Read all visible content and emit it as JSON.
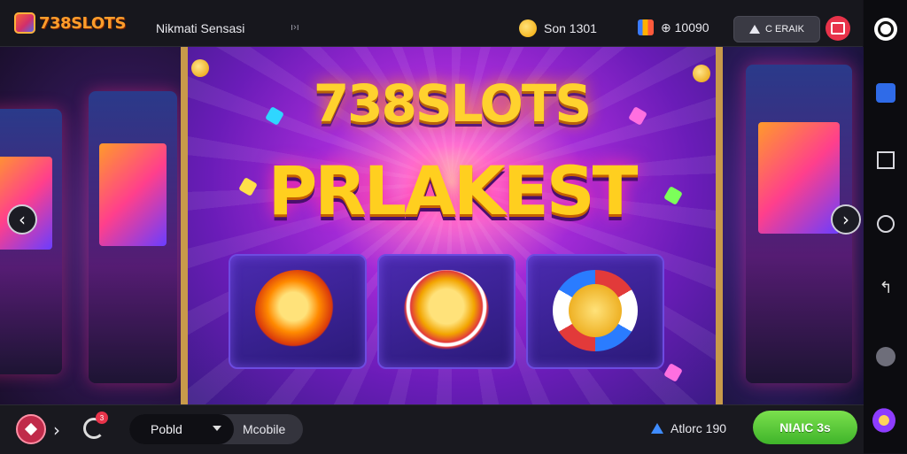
{
  "header": {
    "logo_text": "738SLOTS",
    "tagline": "Nikmati Sensasi",
    "tagline_extra": "ı›ı",
    "coins": "Son 1301",
    "stat2": "⊕ 10090",
    "rank_label": "C ERAIK"
  },
  "promo": {
    "title_top": "738SLOTS",
    "title_main": "PRLAKEST"
  },
  "bottom": {
    "notification_count": "3",
    "select_value": "Pobld",
    "mode_label": "Mcobile",
    "alert_text": "Atlorc 190",
    "main_button": "NIAIC 3s"
  },
  "colors": {
    "accent_green": "#4cc935",
    "accent_gold": "#ffc81e",
    "frame_gold": "#c89a4a",
    "alert_red": "#e8334a"
  },
  "icons": [
    "logo-cube-icon",
    "coin-icon",
    "bars-icon",
    "triangle-icon",
    "gift-icon",
    "prev-arrow-icon",
    "next-arrow-icon",
    "play-icon",
    "refresh-icon",
    "alert-icon",
    "chevron-down-icon"
  ]
}
